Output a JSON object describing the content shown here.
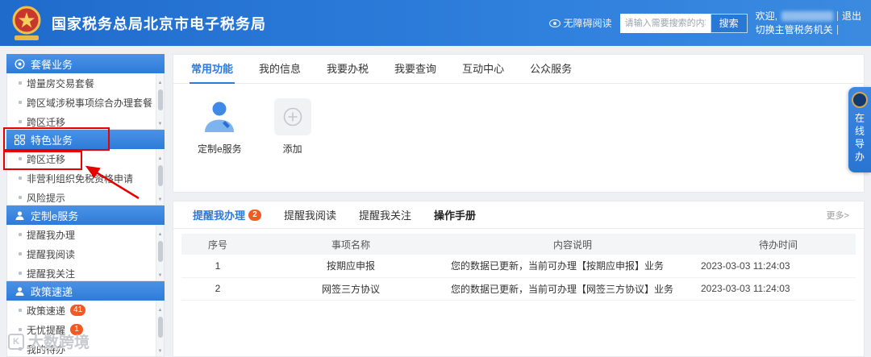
{
  "header": {
    "title": "国家税务总局北京市电子税务局",
    "accessibility_label": "无障碍阅读",
    "search": {
      "placeholder": "请输入需要搜索的内容",
      "button": "搜索"
    },
    "welcome_label": "欢迎,",
    "logout_label": "退出",
    "switch_label": "切换主管税务机关"
  },
  "sidebar": {
    "sections": [
      {
        "title": "套餐业务",
        "icon": "target-icon",
        "items": [
          {
            "label": "增量房交易套餐"
          },
          {
            "label": "跨区域涉税事项综合办理套餐"
          },
          {
            "label": "跨区迁移"
          }
        ]
      },
      {
        "title": "特色业务",
        "icon": "grid-icon",
        "items": [
          {
            "label": "跨区迁移"
          },
          {
            "label": "非营利组织免税资格申请"
          },
          {
            "label": "风险提示"
          }
        ]
      },
      {
        "title": "定制e服务",
        "icon": "person-icon",
        "items": [
          {
            "label": "提醒我办理"
          },
          {
            "label": "提醒我阅读"
          },
          {
            "label": "提醒我关注"
          }
        ]
      },
      {
        "title": "政策速递",
        "icon": "person-icon",
        "items": [
          {
            "label": "政策速递",
            "badge": "41"
          },
          {
            "label": "无忧提醒",
            "badge": "1"
          },
          {
            "label": "我的待办"
          }
        ]
      }
    ]
  },
  "main": {
    "tabs": [
      {
        "label": "常用功能"
      },
      {
        "label": "我的信息"
      },
      {
        "label": "我要办税"
      },
      {
        "label": "我要查询"
      },
      {
        "label": "互动中心"
      },
      {
        "label": "公众服务"
      }
    ],
    "shortcuts": [
      {
        "label": "定制e服务",
        "icon": "person-icon"
      },
      {
        "label": "添加",
        "icon": "plus-icon"
      }
    ],
    "reminders": {
      "tabs": [
        {
          "label": "提醒我办理",
          "badge": "2"
        },
        {
          "label": "提醒我阅读"
        },
        {
          "label": "提醒我关注"
        },
        {
          "label": "操作手册"
        }
      ],
      "more_label": "更多>",
      "table": {
        "headers": [
          "序号",
          "事项名称",
          "内容说明",
          "待办时间"
        ],
        "rows": [
          {
            "no": "1",
            "name": "按期应申报",
            "desc": "您的数据已更新，当前可办理【按期应申报】业务",
            "time": "2023-03-03 11:24:03"
          },
          {
            "no": "2",
            "name": "网签三方协议",
            "desc": "您的数据已更新，当前可办理【网签三方协议】业务",
            "time": "2023-03-03 11:24:03"
          }
        ]
      }
    }
  },
  "floating": {
    "online_guide": "在线导办"
  },
  "watermark": {
    "label": "大数跨境"
  },
  "colors": {
    "accent": "#2a7ae0",
    "badge": "#f25a24",
    "annotation": "#e60000"
  }
}
